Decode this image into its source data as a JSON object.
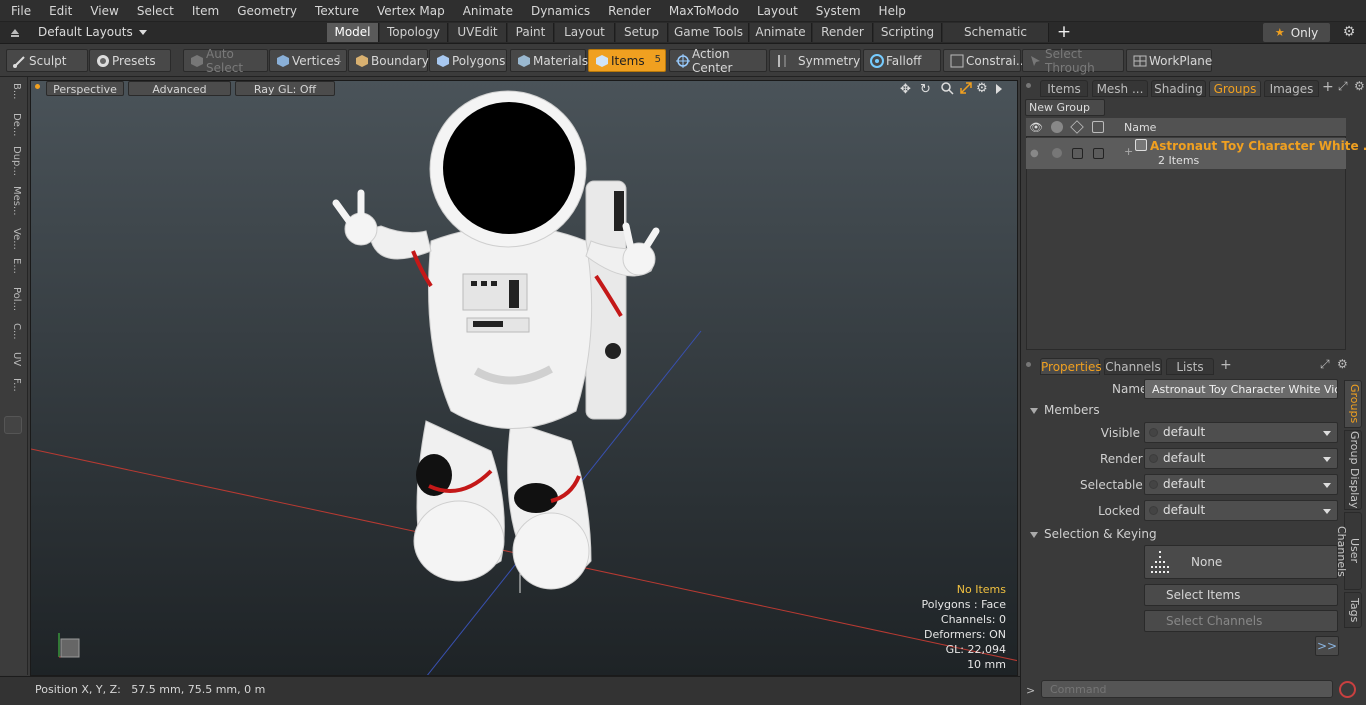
{
  "menubar": {
    "items": [
      "File",
      "Edit",
      "View",
      "Select",
      "Item",
      "Geometry",
      "Texture",
      "Vertex Map",
      "Animate",
      "Dynamics",
      "Render",
      "MaxToModo",
      "Layout",
      "System",
      "Help"
    ]
  },
  "layout": {
    "label": "Default Layouts"
  },
  "workspace_tabs": [
    "Model",
    "Topology",
    "UVEdit",
    "Paint",
    "Layout",
    "Setup",
    "Game Tools",
    "Animate",
    "Render",
    "Scripting",
    "Schematic Fusion"
  ],
  "only_label": "Only",
  "toolbar": {
    "sculpt": "Sculpt",
    "presets": "Presets",
    "auto_select": "Auto Select",
    "vertices": "Vertices",
    "vertices_count": "1",
    "boundary": "Boundary",
    "polygons": "Polygons",
    "materials": "Materials",
    "items": "Items",
    "items_count": "5",
    "action_center": "Action Center",
    "symmetry": "Symmetry",
    "falloff": "Falloff",
    "constraints": "Constrai...",
    "select_through": "Select Through",
    "workplane": "WorkPlane"
  },
  "left_tools": [
    "B...",
    "De...",
    "Dup...",
    "Mes...",
    "Ve...",
    "E...",
    "Pol...",
    "C...",
    "UV",
    "F..."
  ],
  "viewport": {
    "view": "Perspective",
    "shading": "Advanced",
    "raygl": "Ray GL: Off",
    "info": {
      "no_items": "No Items",
      "polygons": "Polygons : Face",
      "channels": "Channels: 0",
      "deformers": "Deformers: ON",
      "gl": "GL: 22,094",
      "scale": "10 mm"
    }
  },
  "status": {
    "position": "Position X, Y, Z:   57.5 mm, 75.5 mm, 0 m"
  },
  "items_panel": {
    "tabs": [
      "Items",
      "Mesh ...",
      "Shading",
      "Groups",
      "Images"
    ],
    "active_tab": "Groups",
    "new_group": "New Group",
    "name_col": "Name",
    "row_name": "Astronaut Toy Character White ...",
    "row_sub": "2 Items"
  },
  "properties": {
    "tabs": [
      "Properties",
      "Channels",
      "Lists"
    ],
    "name_label": "Name",
    "name_value": "Astronaut Toy Character White Victor",
    "members": "Members",
    "fields": [
      {
        "label": "Visible",
        "value": "default"
      },
      {
        "label": "Render",
        "value": "default"
      },
      {
        "label": "Selectable",
        "value": "default"
      },
      {
        "label": "Locked",
        "value": "default"
      }
    ],
    "selection_keying": "Selection & Keying",
    "none": "None",
    "select_items": "Select Items",
    "select_channels": "Select Channels",
    "more": ">>",
    "side_tabs": [
      "Groups",
      "Group Display",
      "User Channels",
      "Tags"
    ]
  },
  "command": {
    "prompt": ">",
    "placeholder": "Command"
  },
  "colors": {
    "accent": "#f0a020",
    "active_tab": "#5a5a5a",
    "viewport_top": "#4a5359",
    "viewport_bottom": "#1e2326"
  }
}
